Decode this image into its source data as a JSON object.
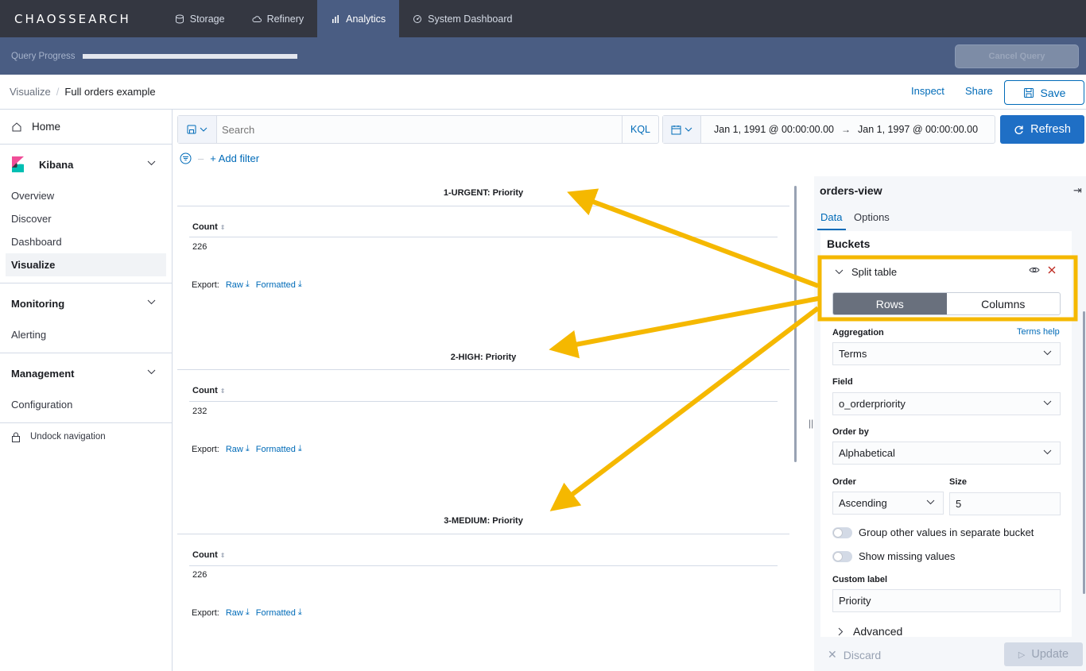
{
  "topnav": {
    "brand": "CHAOSSEARCH",
    "tabs": [
      {
        "label": "Storage",
        "icon": "database-icon"
      },
      {
        "label": "Refinery",
        "icon": "cloud-icon"
      },
      {
        "label": "Analytics",
        "icon": "bar-chart-icon"
      },
      {
        "label": "System Dashboard",
        "icon": "dashboard-icon"
      }
    ]
  },
  "progress": {
    "label": "Query Progress",
    "cancel_label": "Cancel Query"
  },
  "header": {
    "breadcrumb_root": "Visualize",
    "breadcrumb_current": "Full orders example",
    "inspect_label": "Inspect",
    "share_label": "Share",
    "save_label": "Save"
  },
  "sidebar": {
    "home": "Home",
    "sections": [
      {
        "title": "Kibana",
        "items": [
          "Overview",
          "Discover",
          "Dashboard",
          "Visualize"
        ],
        "active": "Visualize"
      },
      {
        "title": "Monitoring",
        "items": [
          "Alerting"
        ]
      },
      {
        "title": "Management",
        "items": [
          "Configuration"
        ]
      }
    ],
    "undock": "Undock navigation"
  },
  "querybar": {
    "placeholder": "Search",
    "kql": "KQL",
    "date_start": "Jan 1, 1991 @ 00:00:00.00",
    "date_arrow": "→",
    "date_end": "Jan 1, 1997 @ 00:00:00.00",
    "refresh_label": "Refresh",
    "add_filter": "+ Add filter"
  },
  "tables": [
    {
      "title": "1-URGENT: Priority",
      "column": "Count",
      "value": "226"
    },
    {
      "title": "2-HIGH: Priority",
      "column": "Count",
      "value": "232"
    },
    {
      "title": "3-MEDIUM: Priority",
      "column": "Count",
      "value": "226"
    }
  ],
  "export": {
    "label": "Export:",
    "raw": "Raw",
    "formatted": "Formatted"
  },
  "panel": {
    "title": "orders-view",
    "tabs": [
      "Data",
      "Options"
    ],
    "buckets_title": "Buckets",
    "split_label": "Split table",
    "rows_label": "Rows",
    "columns_label": "Columns",
    "aggregation_label": "Aggregation",
    "terms_help": "Terms help",
    "aggregation_value": "Terms",
    "field_label": "Field",
    "field_value": "o_orderpriority",
    "order_by_label": "Order by",
    "order_by_value": "Alphabetical",
    "order_label": "Order",
    "order_value": "Ascending",
    "size_label": "Size",
    "size_value": "5",
    "group_other": "Group other values in separate bucket",
    "show_missing": "Show missing values",
    "custom_label_label": "Custom label",
    "custom_label_value": "Priority",
    "advanced": "Advanced",
    "discard": "Discard",
    "update": "Update"
  },
  "colors": {
    "accent": "#006bb8",
    "nav_bg": "#343741",
    "progress_bg": "#4a5d83",
    "annotation": "#f5b800"
  }
}
